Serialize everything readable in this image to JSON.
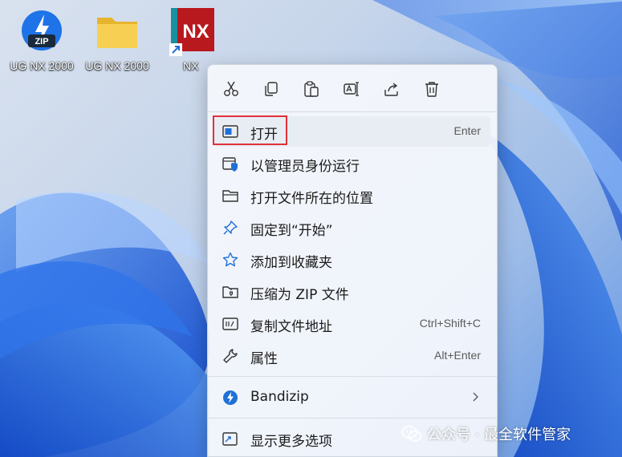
{
  "desktop": {
    "icons": [
      {
        "label": "UG NX 2000",
        "icon": "bandizip-zip-icon",
        "badge": "ZIP"
      },
      {
        "label": "UG NX 2000",
        "icon": "folder-icon"
      },
      {
        "label": "NX",
        "icon": "nx-app-shortcut-icon",
        "badge": "NX"
      }
    ]
  },
  "toolbar": {
    "buttons": [
      {
        "name": "cut",
        "icon": "scissors-icon"
      },
      {
        "name": "copy",
        "icon": "copy-icon"
      },
      {
        "name": "paste",
        "icon": "paste-icon"
      },
      {
        "name": "rename",
        "icon": "rename-icon"
      },
      {
        "name": "share",
        "icon": "share-icon"
      },
      {
        "name": "delete",
        "icon": "trash-icon"
      }
    ]
  },
  "menu": {
    "items": [
      {
        "label": "打开",
        "shortcut": "Enter",
        "icon": "open-window-icon"
      },
      {
        "label": "以管理员身份运行",
        "icon": "admin-shield-icon"
      },
      {
        "label": "打开文件所在的位置",
        "icon": "folder-outline-icon"
      },
      {
        "label": "固定到“开始”",
        "icon": "pin-icon"
      },
      {
        "label": "添加到收藏夹",
        "icon": "star-icon"
      },
      {
        "label": "压缩为 ZIP 文件",
        "icon": "zip-folder-icon"
      },
      {
        "label": "复制文件地址",
        "shortcut": "Ctrl+Shift+C",
        "icon": "copy-path-icon"
      },
      {
        "label": "属性",
        "shortcut": "Alt+Enter",
        "icon": "wrench-icon"
      },
      {
        "label": "Bandizip",
        "icon": "bandizip-icon"
      },
      {
        "label": "显示更多选项",
        "icon": "more-options-icon"
      }
    ]
  },
  "watermark": {
    "text": "公众号 · 最全软件管家",
    "icon": "wechat-icon"
  },
  "colors": {
    "highlight": "#e0303a",
    "accent": "#1f6fd6",
    "nx_red": "#b8191f"
  }
}
